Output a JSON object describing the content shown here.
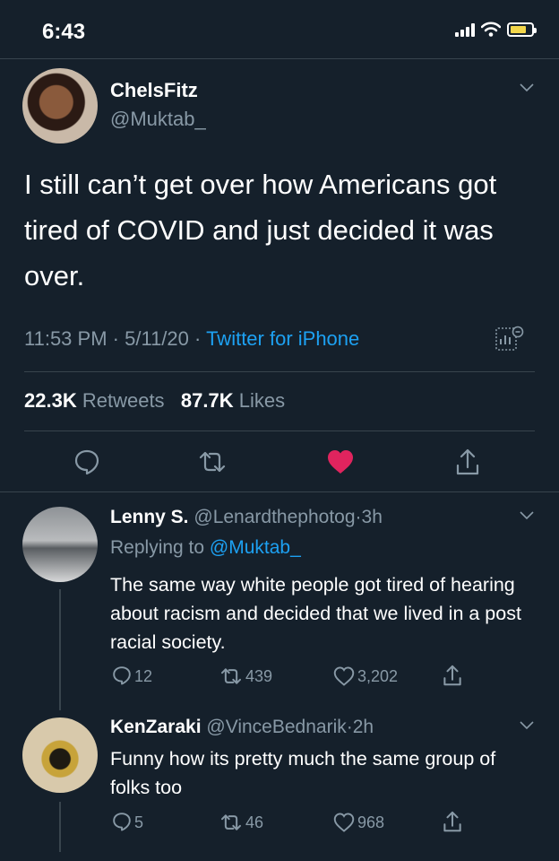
{
  "status": {
    "time": "6:43"
  },
  "tweet": {
    "display_name": "ChelsFitz",
    "handle": "@Muktab_",
    "text": "I still can’t get over how Americans got tired of COVID and just decided it was over.",
    "time": "11:53 PM",
    "date": "5/11/20",
    "source": "Twitter for iPhone",
    "retweets_count": "22.3K",
    "retweets_label": "Retweets",
    "likes_count": "87.7K",
    "likes_label": "Likes",
    "liked_color": "#e0245e"
  },
  "replies": [
    {
      "display_name": "Lenny S.",
      "handle": "@Lenardthephotog",
      "age": "3h",
      "replying_prefix": "Replying to",
      "replying_to": "@Muktab_",
      "text": "The same way white people got tired of hearing about racism and decided that we lived in a post racial society.",
      "comments": "12",
      "retweets": "439",
      "likes": "3,202"
    },
    {
      "display_name": "KenZaraki",
      "handle": "@VinceBednarik",
      "age": "2h",
      "text": "Funny how its pretty much the same group of folks too",
      "comments": "5",
      "retweets": "46",
      "likes": "968"
    }
  ],
  "separator": "·"
}
